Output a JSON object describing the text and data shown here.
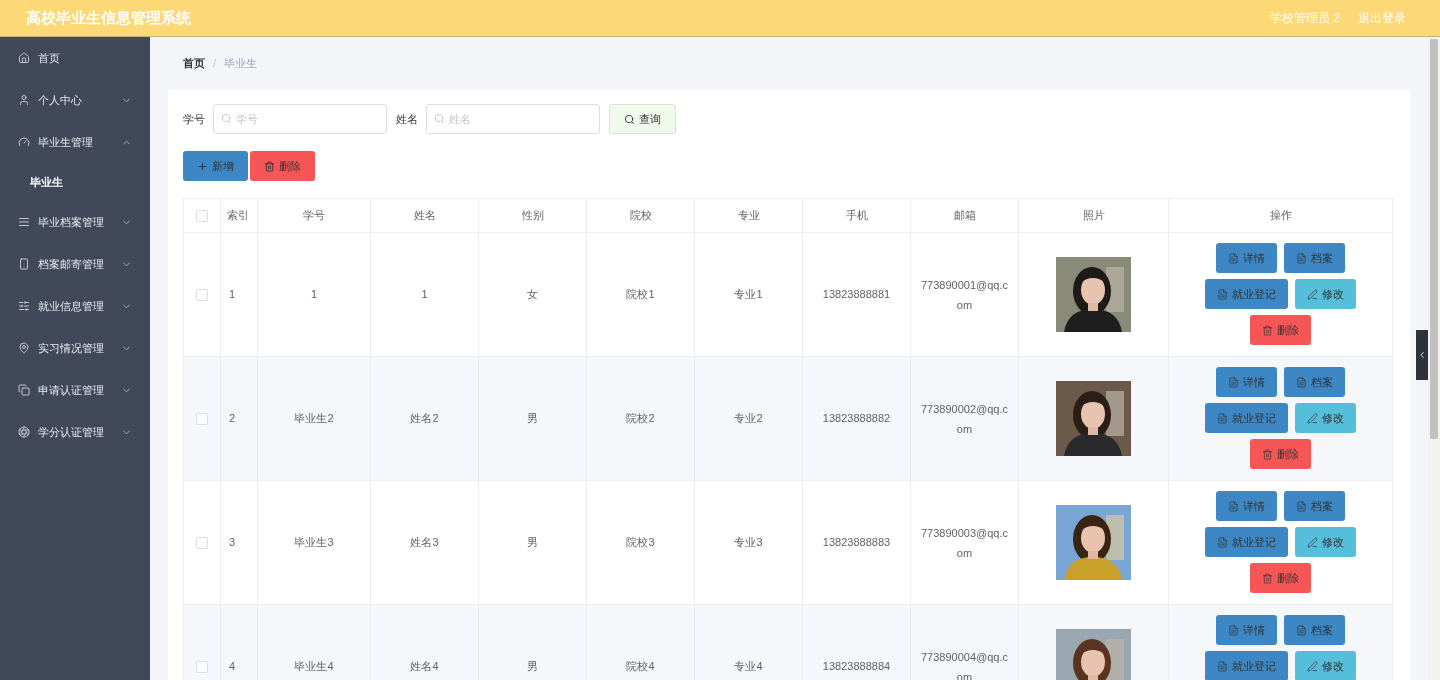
{
  "header": {
    "title": "高校毕业生信息管理系统",
    "user": "学校管理员 2",
    "logout": "退出登录"
  },
  "sidebar": {
    "items": [
      {
        "label": "首页",
        "kind": "link"
      },
      {
        "label": "个人中心",
        "kind": "menu",
        "expanded": false
      },
      {
        "label": "毕业生管理",
        "kind": "menu",
        "expanded": true,
        "children": [
          {
            "label": "毕业生",
            "selected": true
          }
        ]
      },
      {
        "label": "毕业档案管理",
        "kind": "menu",
        "expanded": false
      },
      {
        "label": "档案邮寄管理",
        "kind": "menu",
        "expanded": false
      },
      {
        "label": "就业信息管理",
        "kind": "menu",
        "expanded": false
      },
      {
        "label": "实习情况管理",
        "kind": "menu",
        "expanded": false
      },
      {
        "label": "申请认证管理",
        "kind": "menu",
        "expanded": false
      },
      {
        "label": "学分认证管理",
        "kind": "menu",
        "expanded": false
      }
    ]
  },
  "breadcrumb": {
    "items": [
      "首页",
      "毕业生"
    ],
    "separator": "/"
  },
  "search": {
    "fields": [
      {
        "label": "学号",
        "placeholder": "学号"
      },
      {
        "label": "姓名",
        "placeholder": "姓名"
      }
    ],
    "button": "查询"
  },
  "toolbar": [
    {
      "label": "新增",
      "kind": "add"
    },
    {
      "label": "删除",
      "kind": "delete"
    }
  ],
  "table": {
    "select_all_checked": false,
    "columns": [
      "索引",
      "学号",
      "姓名",
      "性别",
      "院校",
      "专业",
      "手机",
      "邮箱",
      "照片",
      "操作"
    ],
    "rows": [
      {
        "checked": false,
        "cells": [
          "1",
          "1",
          "1",
          "女",
          "院校1",
          "专业1",
          "13823888881",
          "773890001@qq.com"
        ],
        "photo": {
          "kind": "picture"
        },
        "actions": [
          {
            "label": "详情",
            "kind": "primary"
          },
          {
            "label": "档案",
            "kind": "primary"
          },
          {
            "label": "就业登记",
            "kind": "primary"
          },
          {
            "label": "修改",
            "kind": "edit"
          },
          {
            "label": "删除",
            "kind": "danger"
          }
        ]
      },
      {
        "checked": false,
        "cells": [
          "2",
          "毕业生2",
          "姓名2",
          "男",
          "院校2",
          "专业2",
          "13823888882",
          "773890002@qq.com"
        ],
        "photo": {
          "kind": "picture"
        },
        "actions": [
          {
            "label": "详情",
            "kind": "primary"
          },
          {
            "label": "档案",
            "kind": "primary"
          },
          {
            "label": "就业登记",
            "kind": "primary"
          },
          {
            "label": "修改",
            "kind": "edit"
          },
          {
            "label": "删除",
            "kind": "danger"
          }
        ]
      },
      {
        "checked": false,
        "cells": [
          "3",
          "毕业生3",
          "姓名3",
          "男",
          "院校3",
          "专业3",
          "13823888883",
          "773890003@qq.com"
        ],
        "photo": {
          "kind": "picture"
        },
        "actions": [
          {
            "label": "详情",
            "kind": "primary"
          },
          {
            "label": "档案",
            "kind": "primary"
          },
          {
            "label": "就业登记",
            "kind": "primary"
          },
          {
            "label": "修改",
            "kind": "edit"
          },
          {
            "label": "删除",
            "kind": "danger"
          }
        ]
      },
      {
        "checked": false,
        "cells": [
          "4",
          "毕业生4",
          "姓名4",
          "男",
          "院校4",
          "专业4",
          "13823888884",
          "773890004@qq.com"
        ],
        "photo": {
          "kind": "picture"
        },
        "actions": [
          {
            "label": "详情",
            "kind": "primary"
          },
          {
            "label": "档案",
            "kind": "primary"
          },
          {
            "label": "就业登记",
            "kind": "primary"
          },
          {
            "label": "修改",
            "kind": "edit"
          }
        ]
      }
    ]
  }
}
